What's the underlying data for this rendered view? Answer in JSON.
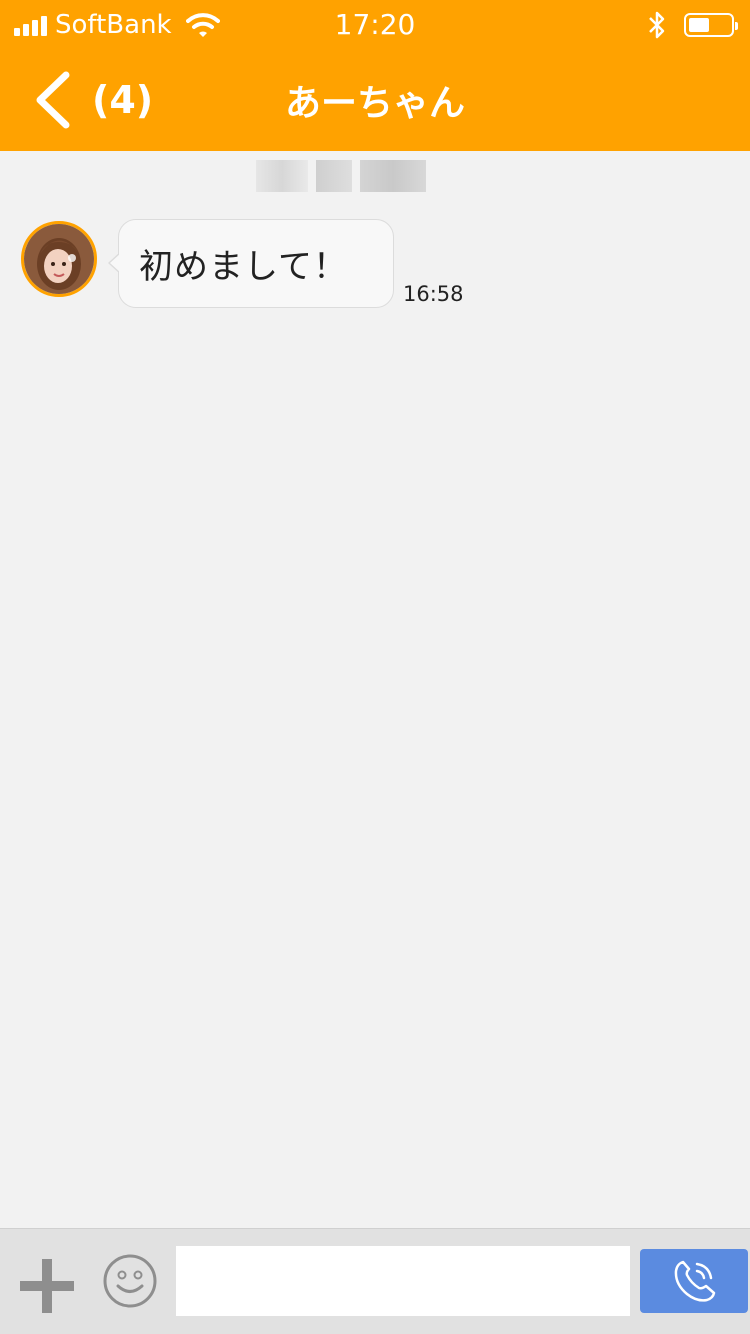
{
  "status_bar": {
    "carrier": "SoftBank",
    "time": "17:20",
    "icons": [
      "signal-icon",
      "wifi-icon",
      "bluetooth-icon",
      "battery-icon"
    ]
  },
  "nav": {
    "back_count": "(4)",
    "title": "あーちゃん"
  },
  "messages": [
    {
      "sender": "あーちゃん",
      "text": "初めまして！",
      "time": "16:58"
    }
  ],
  "composer": {
    "placeholder": "",
    "icons": [
      "plus-icon",
      "smiley-icon",
      "phone-icon"
    ]
  },
  "colors": {
    "header": "#ffa200",
    "background": "#f2f2f2",
    "call_button": "#5b8be0"
  }
}
